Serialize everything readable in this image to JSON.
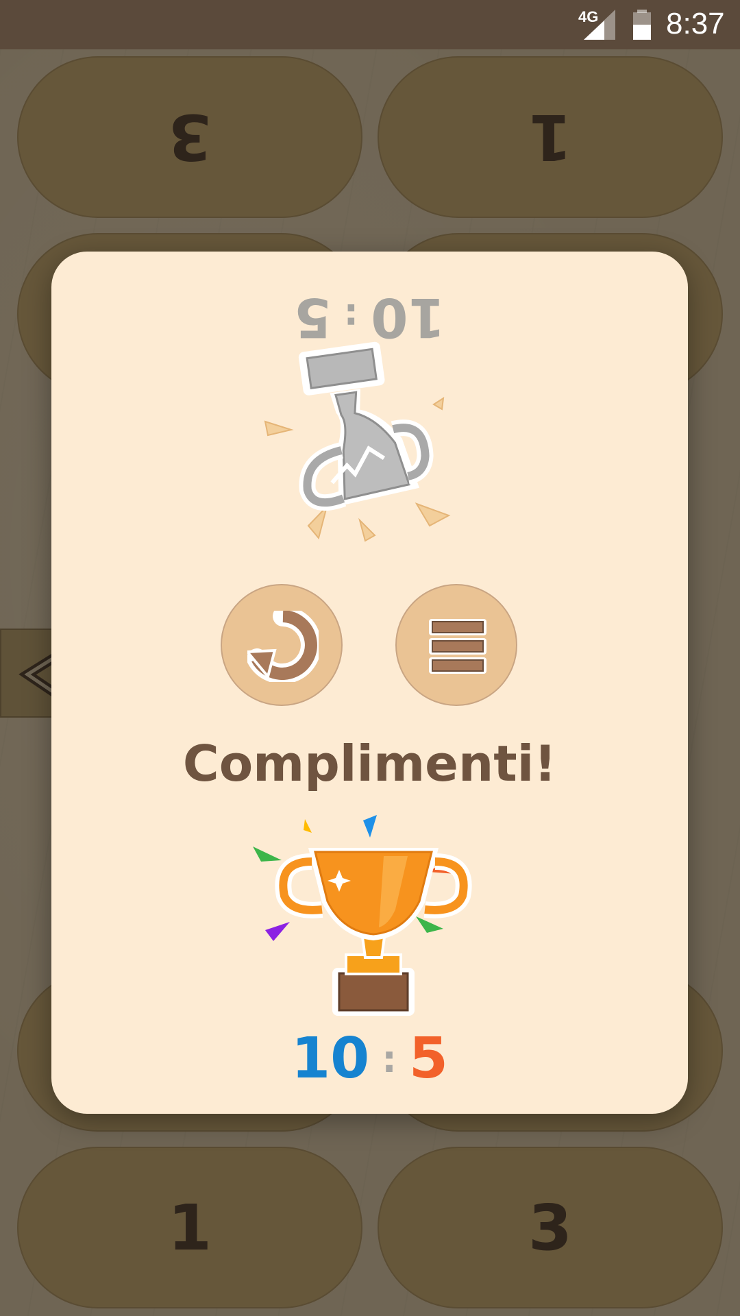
{
  "status_bar": {
    "network": "4G",
    "time": "8:37"
  },
  "tiles": {
    "top_left": "3",
    "top_right": "1",
    "bottom_left": "1",
    "bottom_right": "3"
  },
  "dialog": {
    "title": "Complimenti!",
    "opponent_score": {
      "left": "10",
      "separator": ":",
      "right": "5"
    },
    "player_score": {
      "left": "10",
      "separator": ":",
      "right": "5"
    },
    "buttons": {
      "restart_icon": "restart-icon",
      "menu_icon": "menu-icon"
    }
  },
  "colors": {
    "dialog_bg": "#fdebd3",
    "title": "#6f5440",
    "score_blue": "#1683d0",
    "score_orange": "#f2612a",
    "button_bg": "#eac394"
  }
}
